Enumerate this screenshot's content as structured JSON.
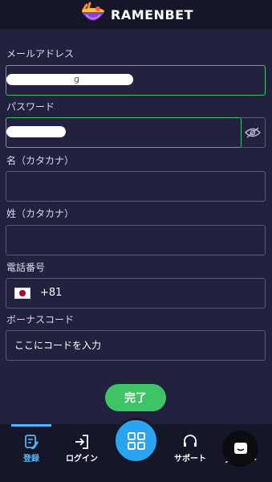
{
  "header": {
    "brand": "RAMENBET"
  },
  "form": {
    "email_label": "メールアドレス",
    "email_value_visible": "g",
    "password_label": "パスワード",
    "first_name_label": "名（カタカナ）",
    "first_name_value": "",
    "last_name_label": "姓（カタカナ）",
    "last_name_value": "",
    "phone_label": "電話番号",
    "phone_country": "Japan",
    "phone_prefix": "+81",
    "bonus_label": "ボーナスコード",
    "bonus_placeholder": "ここにコードを入力",
    "submit_label": "完了"
  },
  "nav": {
    "register": "登録",
    "login": "ログイン",
    "support": "サポート",
    "more_partial": "メニュー"
  },
  "colors": {
    "background": "#22223f",
    "header": "#161629",
    "valid_border": "#39c36e",
    "accent_blue": "#2aa3f0",
    "submit_green": "#3fc465"
  },
  "icons": {
    "eye": "eye-toggle-icon",
    "register": "edit-icon",
    "login": "login-icon",
    "menu": "grid-icon",
    "support": "headset-icon",
    "chat": "chat-icon"
  }
}
